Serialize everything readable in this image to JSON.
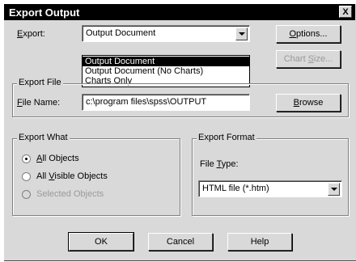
{
  "window": {
    "title": "Export Output",
    "close_glyph": "X"
  },
  "export": {
    "label": "Export:",
    "selected": "Output Document",
    "options": [
      "Output Document",
      "Output Document (No Charts)",
      "Charts Only"
    ],
    "selected_index": 0
  },
  "buttons": {
    "options": "Options...",
    "chart_size": "Chart Size...",
    "browse": "Browse",
    "ok": "OK",
    "cancel": "Cancel",
    "help": "Help"
  },
  "export_file": {
    "group_label": "Export File",
    "file_name_label": "File Name:",
    "file_name_value": "c:\\program files\\spss\\OUTPUT"
  },
  "export_what": {
    "group_label": "Export What",
    "options": [
      {
        "label": "All Objects",
        "checked": true,
        "enabled": true
      },
      {
        "label": "All Visible Objects",
        "checked": false,
        "enabled": true
      },
      {
        "label": "Selected Objects",
        "checked": false,
        "enabled": false
      }
    ]
  },
  "export_format": {
    "group_label": "Export Format",
    "file_type_label": "File Type:",
    "file_type_value": "HTML file (*.htm)"
  }
}
